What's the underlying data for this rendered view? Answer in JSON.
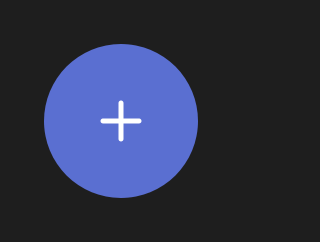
{
  "screen": {
    "background_color": "#1e1e1e"
  },
  "fab": {
    "icon": "plus-icon",
    "background_color": "#5a6fd1",
    "icon_color": "#ffffff"
  }
}
